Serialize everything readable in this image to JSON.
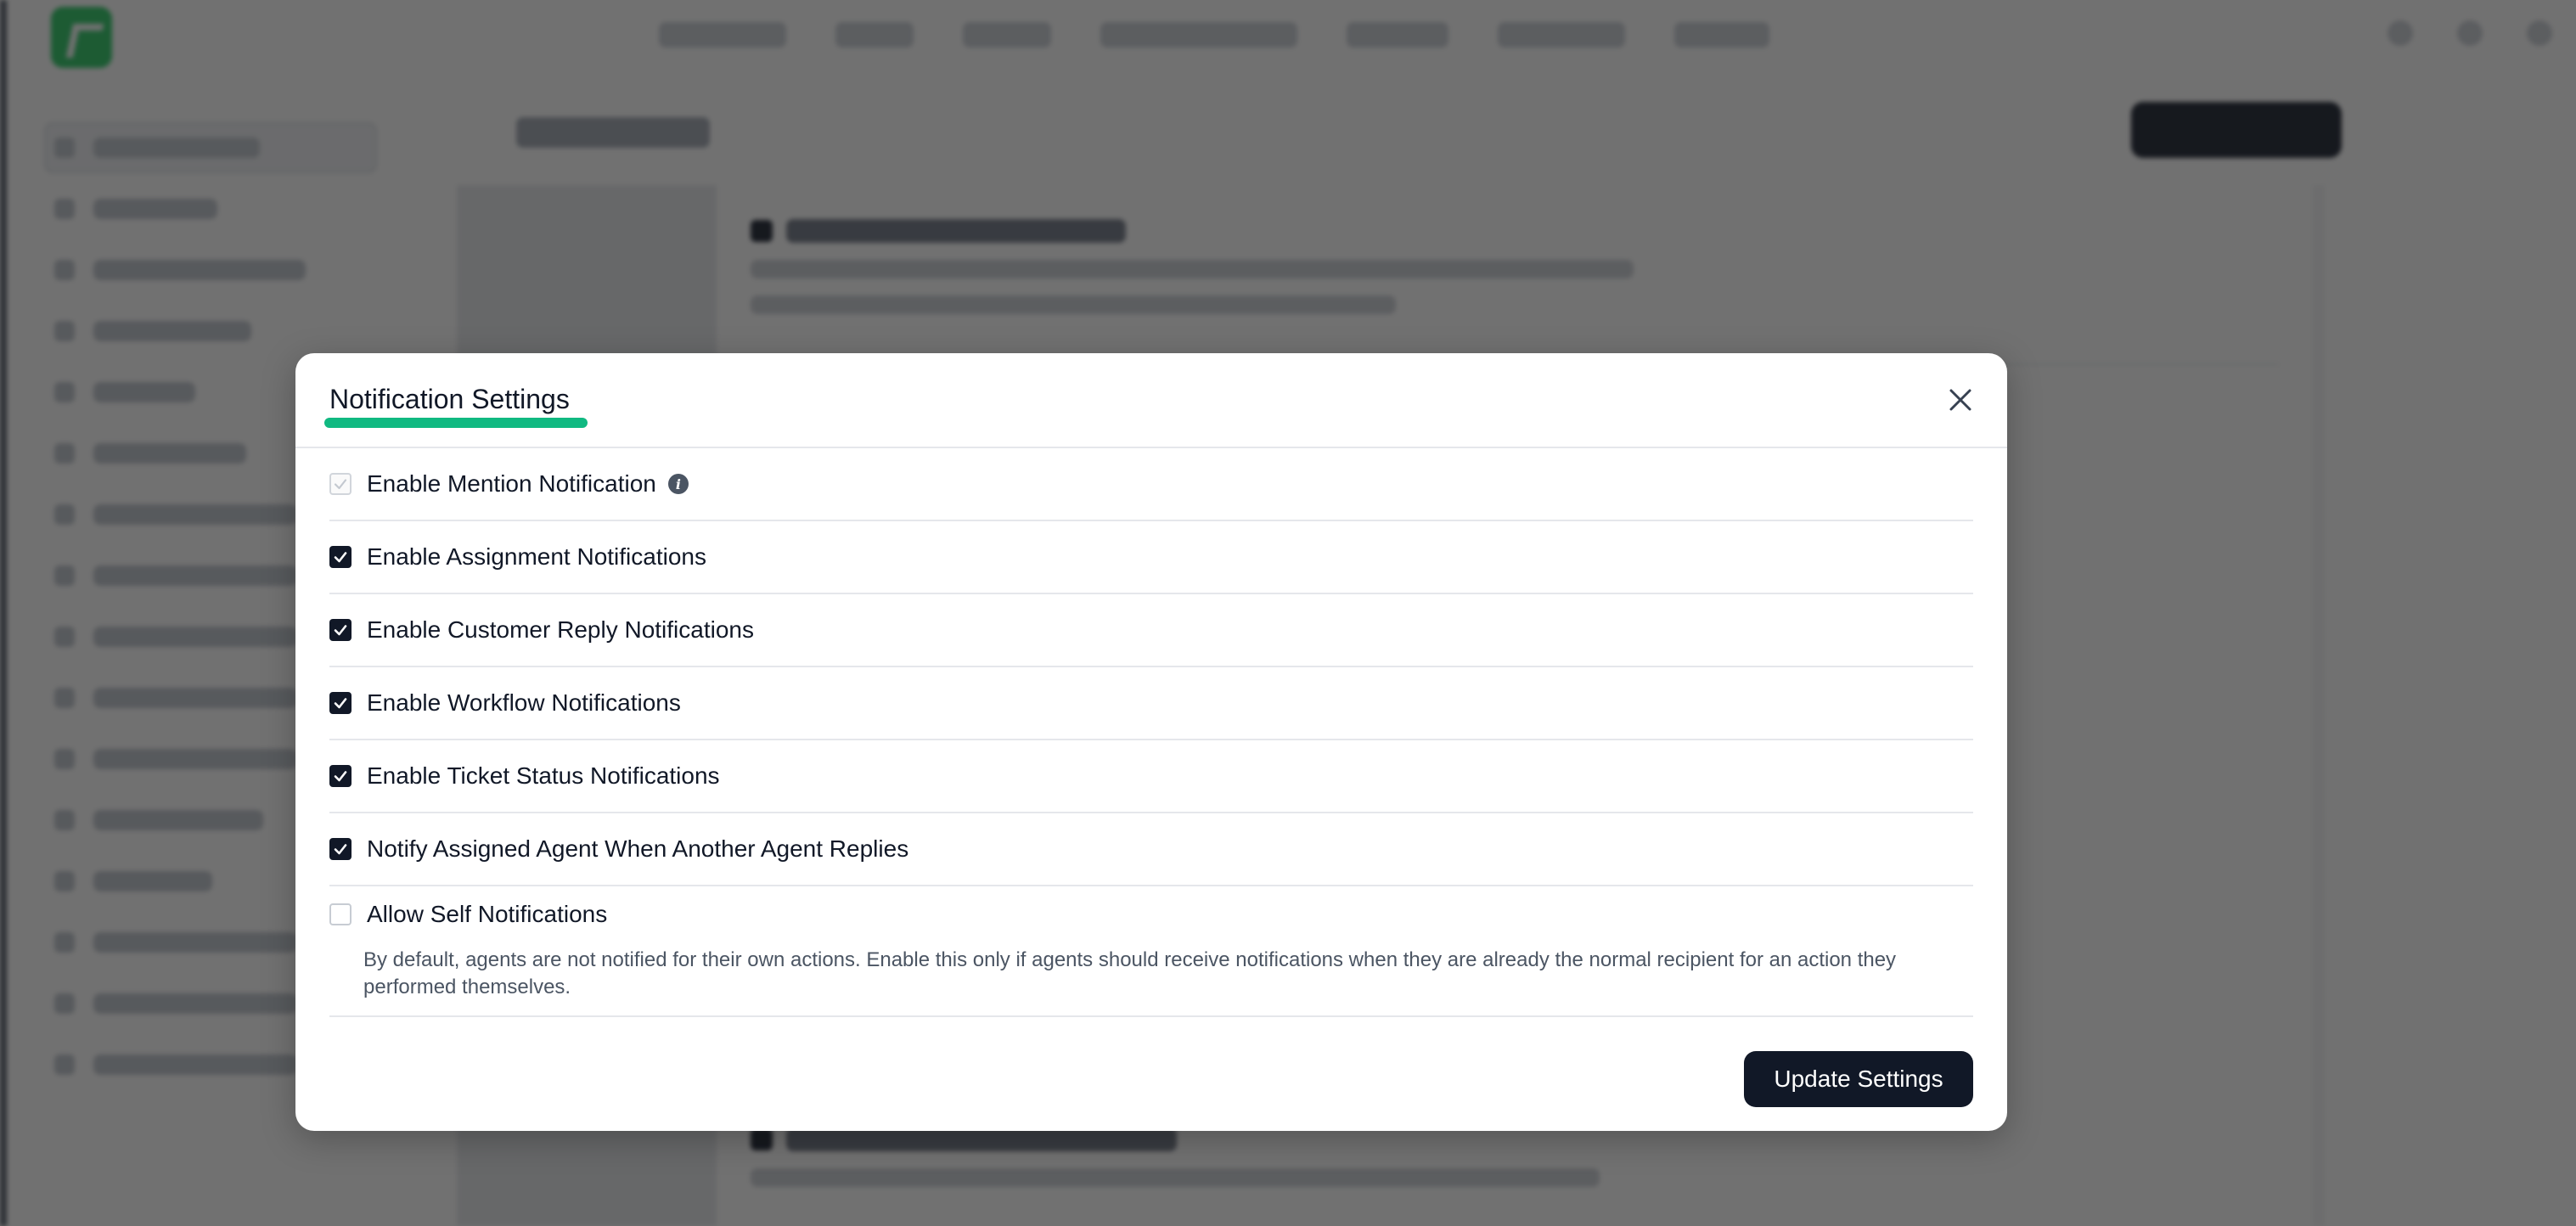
{
  "modal": {
    "title": "Notification Settings",
    "close_icon": "close-icon",
    "info_icon": "info-icon",
    "accent_color": "#10b981",
    "options": [
      {
        "label": "Enable Mention Notification",
        "state": "checked-disabled",
        "has_info": true
      },
      {
        "label": "Enable Assignment Notifications",
        "state": "checked"
      },
      {
        "label": "Enable Customer Reply Notifications",
        "state": "checked"
      },
      {
        "label": "Enable Workflow Notifications",
        "state": "checked"
      },
      {
        "label": "Enable Ticket Status Notifications",
        "state": "checked"
      },
      {
        "label": "Notify Assigned Agent When Another Agent Replies",
        "state": "checked"
      },
      {
        "label": "Allow Self Notifications",
        "state": "unchecked",
        "description": "By default, agents are not notified for their own actions. Enable this only if agents should receive notifications when they are already the normal recipient for an action they performed themselves."
      }
    ],
    "update_label": "Update Settings"
  }
}
